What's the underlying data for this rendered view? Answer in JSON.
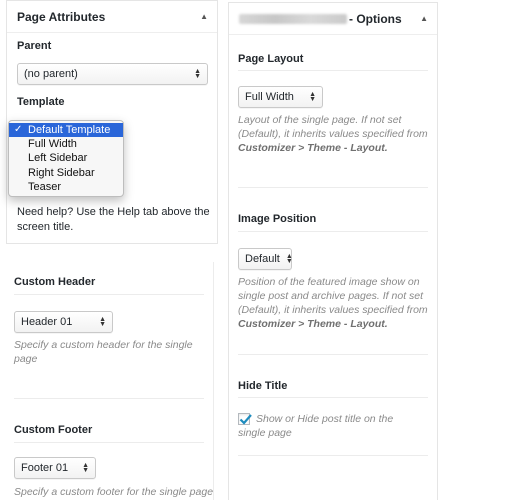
{
  "page_attributes": {
    "title": "Page Attributes",
    "parent_label": "Parent",
    "parent_value": "(no parent)",
    "template_label": "Template",
    "template_options": [
      "Default Template",
      "Full Width",
      "Left Sidebar",
      "Right Sidebar",
      "Teaser"
    ],
    "template_selected": "Default Template",
    "help_text_1": "Need help? Use the Help tab above the",
    "help_text_2": "screen title."
  },
  "custom_header": {
    "title": "Custom Header",
    "value": "Header 01",
    "desc_1": "Specify a custom header for the single",
    "desc_2": "page"
  },
  "custom_footer": {
    "title": "Custom Footer",
    "value": "Footer 01",
    "desc_1": "Specify a custom footer for the single page"
  },
  "options": {
    "title_suffix": "- Options",
    "page_layout": {
      "label": "Page Layout",
      "value": "Full Width",
      "desc_1": "Layout of the single page. If not set",
      "desc_2": "(Default), it inherits values specified from",
      "desc_3": "Customizer > Theme - Layout."
    },
    "image_position": {
      "label": "Image Position",
      "value": "Default",
      "desc_1": "Position of the featured image show on",
      "desc_2": "single post and archive pages. If not set",
      "desc_3": "(Default), it inherits values specified from",
      "desc_4": "Customizer > Theme - Layout."
    },
    "hide_title": {
      "label": "Hide Title",
      "checked": true,
      "checkbox_text_1": "Show or Hide post title on the",
      "checkbox_text_2": "single page"
    }
  },
  "icons": {
    "collapse": "triangle-up-icon",
    "select_arrows": "up-down-arrows-icon",
    "check": "checkmark-icon"
  },
  "colors": {
    "selection_blue": "#2a66d9",
    "checkbox_check": "#1e8cbe",
    "description_gray": "#8a8a8a"
  }
}
